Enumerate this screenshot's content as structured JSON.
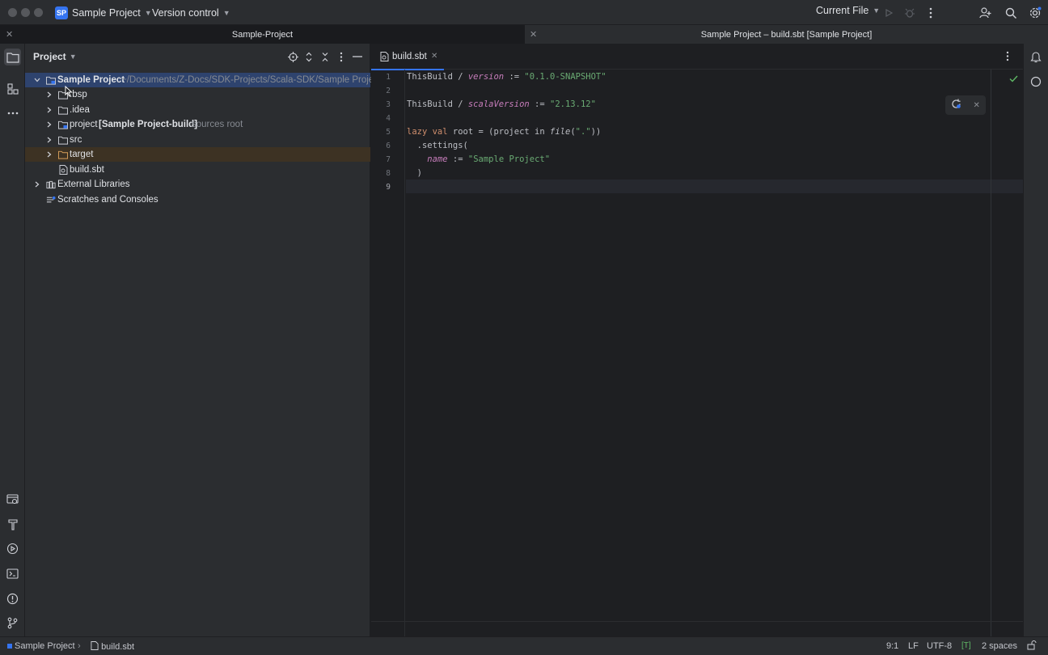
{
  "titlebar": {
    "project_badge": "SP",
    "project_name": "Sample Project",
    "vcs_label": "Version control",
    "run_config": "Current File"
  },
  "window_tabs": [
    {
      "label": "Sample-Project",
      "active": false
    },
    {
      "label": "Sample Project – build.sbt [Sample Project]",
      "active": true
    }
  ],
  "project_panel": {
    "title": "Project",
    "tree": [
      {
        "label": "Sample Project",
        "hint": "~/Documents/Z-Docs/SDK-Projects/Scala-SDK/Sample Project",
        "icon": "module-folder-icon",
        "expanded": true
      },
      {
        "label": ".bsp",
        "icon": "folder-icon"
      },
      {
        "label": ".idea",
        "icon": "folder-icon"
      },
      {
        "label": "project",
        "bold_suffix": "[Sample Project-build]",
        "hint": "sources root",
        "icon": "module-folder-icon"
      },
      {
        "label": "src",
        "icon": "folder-icon"
      },
      {
        "label": "target",
        "icon": "folder-icon"
      },
      {
        "label": "build.sbt",
        "icon": "sbt-file-icon"
      },
      {
        "label": "External Libraries",
        "icon": "library-icon"
      },
      {
        "label": "Scratches and Consoles",
        "icon": "scratches-icon"
      }
    ]
  },
  "editor": {
    "tab_label": "build.sbt",
    "line_numbers": [
      "1",
      "2",
      "3",
      "4",
      "5",
      "6",
      "7",
      "8",
      "9"
    ],
    "lines": {
      "l1a": "ThisBuild / ",
      "l1b": "version",
      "l1c": " := ",
      "l1d": "\"0.1.0-SNAPSHOT\"",
      "l3a": "ThisBuild / ",
      "l3b": "scalaVersion",
      "l3c": " := ",
      "l3d": "\"2.13.12\"",
      "l5a": "lazy val",
      "l5b": " root = (project in ",
      "l5c": "file",
      "l5d": "(",
      "l5e": "\".\"",
      "l5f": "))",
      "l6": "  .settings(",
      "l7a": "    ",
      "l7b": "name",
      "l7c": " := ",
      "l7d": "\"Sample Project\"",
      "l8": "  )"
    }
  },
  "statusbar": {
    "breadcrumb_project": "Sample Project",
    "breadcrumb_file": "build.sbt",
    "position": "9:1",
    "line_sep": "LF",
    "encoding": "UTF-8",
    "indent": "2 spaces"
  },
  "colors": {
    "accent": "#3574f0",
    "background": "#1e1f22",
    "panel": "#2b2d30"
  }
}
